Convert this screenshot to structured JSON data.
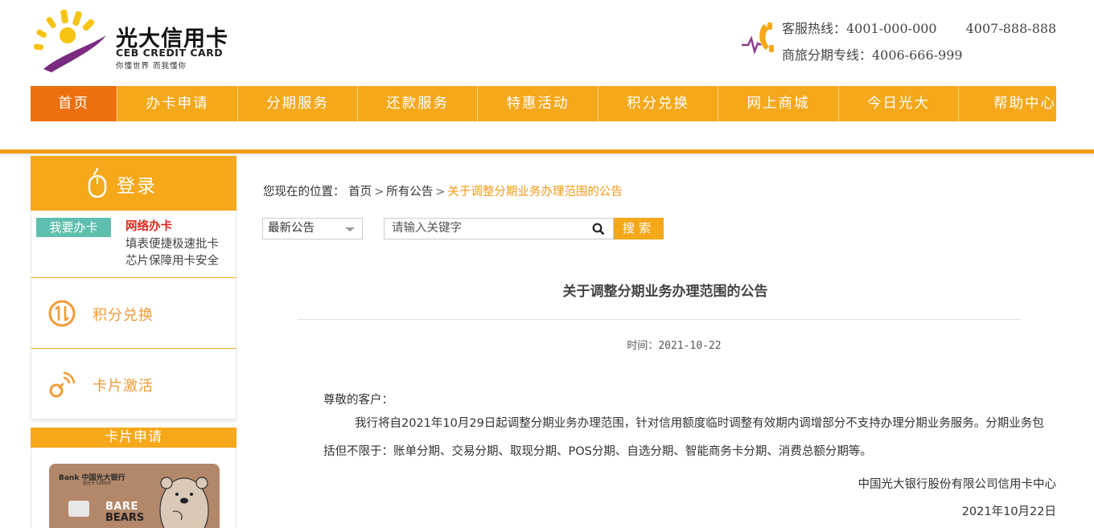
{
  "header": {
    "logo_title": "光大信用卡",
    "logo_en": "CEB CREDIT CARD",
    "logo_slogan": "你懂世界   而我懂你",
    "hotline_label": "客服热线：4001-000-000",
    "hotline_second": "4007-888-888",
    "installment_line": "商旅分期专线：4006-666-999"
  },
  "nav": {
    "items": [
      {
        "label": "首页",
        "active": true
      },
      {
        "label": "办卡申请"
      },
      {
        "label": "分期服务"
      },
      {
        "label": "还款服务"
      },
      {
        "label": "特惠活动"
      },
      {
        "label": "积分兑换"
      },
      {
        "label": "网上商城"
      },
      {
        "label": "今日光大"
      },
      {
        "label": "帮助中心"
      }
    ]
  },
  "sidebar": {
    "login_label": "登录",
    "apply_tag": "我要办卡",
    "apply_title": "网络办卡",
    "apply_line1": "填表便捷极速批卡",
    "apply_line2": "芯片保障用卡安全",
    "points_label": "积分兑换",
    "activate_label": "卡片激活",
    "card_apply_head": "卡片申请",
    "card": {
      "bank_text": "Bank  中国光大银行",
      "sub_text": "阳光卡  CREDIT",
      "bears_line1": "BARE",
      "bears_line2": "BEARS"
    }
  },
  "main": {
    "crumbs": {
      "prefix": "您现在的位置：",
      "home": "首页",
      "all": "所有公告",
      "current": "关于调整分期业务办理范围的公告"
    },
    "select_value": "最新公告",
    "search_placeholder": "请输入关键字",
    "search_button": "搜索",
    "article": {
      "title": "关于调整分期业务办理范围的公告",
      "time_label": "时间：",
      "time_value": "2021-10-22",
      "greeting": "尊敬的客户：",
      "body": "我行将自2021年10月29日起调整分期业务办理范围，针对信用额度临时调整有效期内调增部分不支持办理分期业务服务。分期业务包括但不限于：账单分期、交易分期、取现分期、POS分期、自选分期、智能商务卡分期、消费总额分期等。",
      "signature": "中国光大银行股份有限公司信用卡中心",
      "date": "2021年10月22日"
    }
  },
  "colors": {
    "accent": "#f5a81a",
    "active_nav": "#ee6f0e",
    "apply_tag": "#5fbfae",
    "apply_title": "#e4261c",
    "side_label": "#f29a35"
  }
}
